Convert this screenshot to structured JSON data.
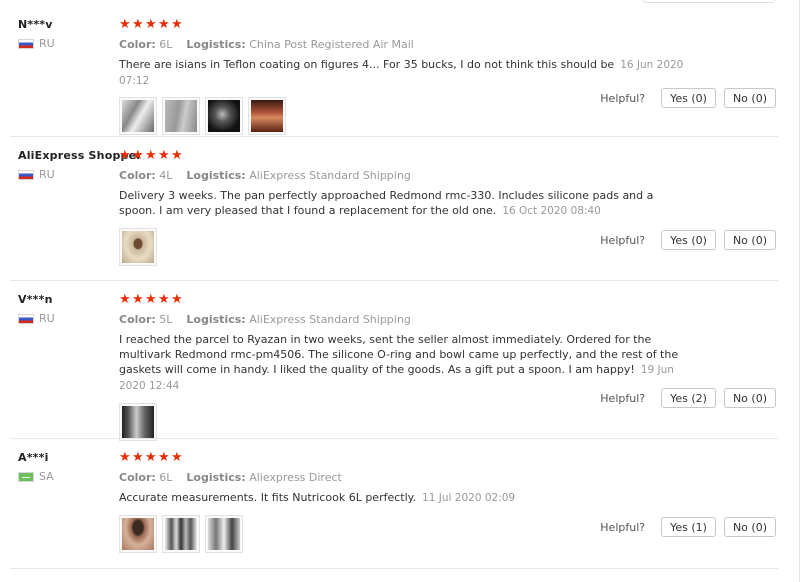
{
  "labels": {
    "color": "Color:",
    "logistics": "Logistics:",
    "helpful": "Helpful?"
  },
  "reviews": [
    {
      "user": "N***v",
      "country": "RU",
      "flag": "ru",
      "rating": 5,
      "color": "6L",
      "logistics": "China Post Registered Air Mail",
      "text": "There are isians in Teflon coating on figures 4... For 35 bucks, I do not think this should be",
      "date": "16 Jun 2020 07:12",
      "photos": [
        "pan-photo-1",
        "pan-photo-2",
        "pan-photo-3",
        "pan-photo-4"
      ],
      "yes": "Yes (0)",
      "no": "No (0)"
    },
    {
      "user": "AliExpress Shopper",
      "country": "RU",
      "flag": "ru",
      "rating": 5,
      "color": "4L",
      "logistics": "AliExpress Standard Shipping",
      "text": "Delivery 3 weeks. The pan perfectly approached Redmond rmc-330. Includes silicone pads and a spoon. I am very pleased that I found a replacement for the old one.",
      "date": "16 Oct 2020 08:40",
      "photos": [
        "pan-photo-1"
      ],
      "yes": "Yes (0)",
      "no": "No (0)"
    },
    {
      "user": "V***n",
      "country": "RU",
      "flag": "ru",
      "rating": 5,
      "color": "5L",
      "logistics": "AliExpress Standard Shipping",
      "text": "I reached the parcel to Ryazan in two weeks, sent the seller almost immediately. Ordered for the multivark Redmond rmc-pm4506. The silicone O-ring and bowl came up perfectly, and the rest of the gaskets will come in handy. I liked the quality of the goods. As a gift put a spoon. I am happy!",
      "date": "19 Jun 2020 12:44",
      "photos": [
        "pan-photo-1"
      ],
      "yes": "Yes (2)",
      "no": "No (0)"
    },
    {
      "user": "A***i",
      "country": "SA",
      "flag": "sa",
      "rating": 5,
      "color": "6L",
      "logistics": "Aliexpress Direct",
      "text": "Accurate measurements. It fits Nutricook 6L perfectly.",
      "date": "11 Jul 2020 02:09",
      "photos": [
        "pan-photo-1",
        "pan-photo-2",
        "pan-photo-3"
      ],
      "yes": "Yes (1)",
      "no": "No (0)"
    }
  ]
}
